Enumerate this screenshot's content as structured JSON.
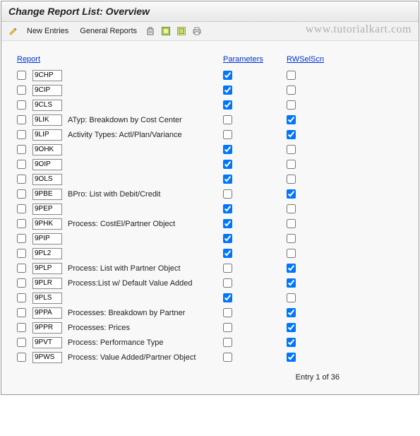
{
  "title": "Change Report List: Overview",
  "toolbar": {
    "new_entries": "New Entries",
    "general_reports": "General Reports"
  },
  "watermark": "www.tutorialkart.com",
  "headers": {
    "report": "Report",
    "parameters": "Parameters",
    "rwselscn": "RWSelScn"
  },
  "rows": [
    {
      "sel": false,
      "code": "9CHP",
      "desc": "",
      "param": true,
      "rw": false
    },
    {
      "sel": false,
      "code": "9CIP",
      "desc": "",
      "param": true,
      "rw": false
    },
    {
      "sel": false,
      "code": "9CLS",
      "desc": "",
      "param": true,
      "rw": false
    },
    {
      "sel": false,
      "code": "9LIK",
      "desc": "ATyp: Breakdown by Cost Center",
      "param": false,
      "rw": true
    },
    {
      "sel": false,
      "code": "9LIP",
      "desc": "Activity Types: Actl/Plan/Variance",
      "param": false,
      "rw": true
    },
    {
      "sel": false,
      "code": "9OHK",
      "desc": "",
      "param": true,
      "rw": false
    },
    {
      "sel": false,
      "code": "9OIP",
      "desc": "",
      "param": true,
      "rw": false
    },
    {
      "sel": false,
      "code": "9OLS",
      "desc": "",
      "param": true,
      "rw": false
    },
    {
      "sel": false,
      "code": "9PBE",
      "desc": "BPro: List with Debit/Credit",
      "param": false,
      "rw": true
    },
    {
      "sel": false,
      "code": "9PEP",
      "desc": "",
      "param": true,
      "rw": false
    },
    {
      "sel": false,
      "code": "9PHK",
      "desc": "Process: CostEl/Partner Object",
      "param": true,
      "rw": false
    },
    {
      "sel": false,
      "code": "9PIP",
      "desc": "",
      "param": true,
      "rw": false
    },
    {
      "sel": false,
      "code": "9PL2",
      "desc": "",
      "param": true,
      "rw": false
    },
    {
      "sel": false,
      "code": "9PLP",
      "desc": "Process: List with Partner Object",
      "param": false,
      "rw": true
    },
    {
      "sel": false,
      "code": "9PLR",
      "desc": "Process:List w/ Default Value Added",
      "param": false,
      "rw": true
    },
    {
      "sel": false,
      "code": "9PLS",
      "desc": "",
      "param": true,
      "rw": false
    },
    {
      "sel": false,
      "code": "9PPA",
      "desc": "Processes: Breakdown by Partner",
      "param": false,
      "rw": true
    },
    {
      "sel": false,
      "code": "9PPR",
      "desc": "Processes: Prices",
      "param": false,
      "rw": true
    },
    {
      "sel": false,
      "code": "9PVT",
      "desc": "Process: Performance Type",
      "param": false,
      "rw": true
    },
    {
      "sel": false,
      "code": "9PWS",
      "desc": "Process: Value Added/Partner Object",
      "param": false,
      "rw": true
    }
  ],
  "footer": "Entry 1 of 36"
}
